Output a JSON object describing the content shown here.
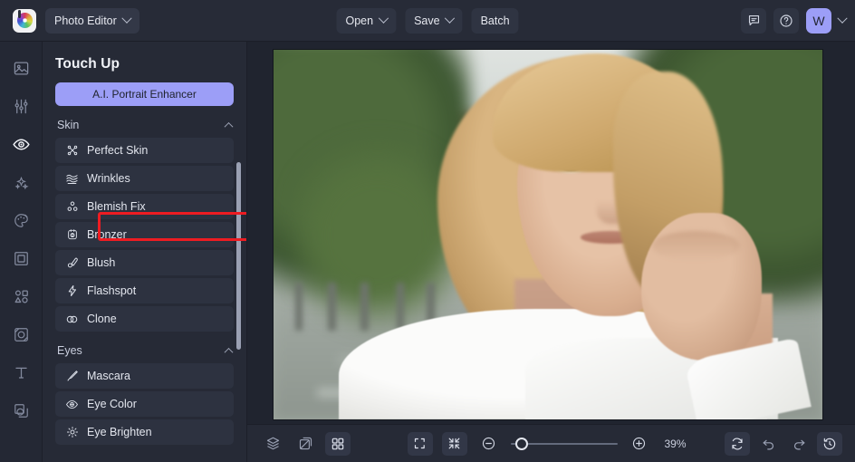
{
  "app": {
    "logo_icon": "color-wheel-logo",
    "mode_label": "Photo Editor"
  },
  "topbar": {
    "open_label": "Open",
    "save_label": "Save",
    "batch_label": "Batch",
    "feedback_icon": "chat-bubble-icon",
    "help_icon": "question-mark-circle-icon",
    "avatar_initial": "W",
    "avatar_color": "#9c9ef7"
  },
  "rail": {
    "items": [
      {
        "name": "image",
        "icon": "image-icon",
        "active": false
      },
      {
        "name": "adjust",
        "icon": "sliders-icon",
        "active": false
      },
      {
        "name": "touchup",
        "icon": "eye-icon",
        "active": true
      },
      {
        "name": "effects",
        "icon": "sparkles-icon",
        "active": false
      },
      {
        "name": "color",
        "icon": "palette-icon",
        "active": false
      },
      {
        "name": "frame",
        "icon": "frame-icon",
        "active": false
      },
      {
        "name": "shapes",
        "icon": "shapes-icon",
        "active": false
      },
      {
        "name": "texture",
        "icon": "texture-icon",
        "active": false
      },
      {
        "name": "text",
        "icon": "text-t-icon",
        "active": false
      },
      {
        "name": "layers",
        "icon": "overlay-icon",
        "active": false
      }
    ]
  },
  "panel": {
    "title": "Touch Up",
    "ai_button_label": "A.I. Portrait Enhancer",
    "ai_button_color": "#9c9ef7",
    "highlight_color": "#ee1c22",
    "sections": [
      {
        "label": "Skin",
        "collapse_icon": "chevron-up-icon",
        "items": [
          {
            "label": "Perfect Skin",
            "icon": "perfect-skin-icon",
            "highlighted": false
          },
          {
            "label": "Wrinkles",
            "icon": "wrinkles-icon",
            "highlighted": true
          },
          {
            "label": "Blemish Fix",
            "icon": "blemish-fix-icon",
            "highlighted": false
          },
          {
            "label": "Bronzer",
            "icon": "bronzer-icon",
            "highlighted": false
          },
          {
            "label": "Blush",
            "icon": "blush-brush-icon",
            "highlighted": false
          },
          {
            "label": "Flashspot",
            "icon": "lightning-icon",
            "highlighted": false
          },
          {
            "label": "Clone",
            "icon": "clone-icon",
            "highlighted": false
          }
        ]
      },
      {
        "label": "Eyes",
        "collapse_icon": "chevron-up-icon",
        "items": [
          {
            "label": "Mascara",
            "icon": "mascara-wand-icon",
            "highlighted": false
          },
          {
            "label": "Eye Color",
            "icon": "eye-color-icon",
            "highlighted": false
          },
          {
            "label": "Eye Brighten",
            "icon": "eye-brighten-icon",
            "highlighted": false
          }
        ]
      }
    ]
  },
  "canvas": {
    "image_description": "Portrait photo of an older blonde woman in a white blouse resting her cheek on her hand, blurred tree-lined street in the background"
  },
  "bottombar": {
    "left_tools": [
      {
        "name": "layers",
        "icon": "layers-stack-icon",
        "active": false
      },
      {
        "name": "compare",
        "icon": "compare-split-icon",
        "active": false
      },
      {
        "name": "grid",
        "icon": "grid-four-icon",
        "active": true
      }
    ],
    "view_tools": [
      {
        "name": "fullscreen",
        "icon": "expand-brackets-icon",
        "active": true
      },
      {
        "name": "fit-screen",
        "icon": "collapse-arrows-icon",
        "active": true
      }
    ],
    "zoom_out_icon": "minus-circle-icon",
    "zoom_in_icon": "plus-circle-icon",
    "zoom_level": "39%",
    "zoom_slider_position_pct": 12,
    "right_tools": [
      {
        "name": "reset",
        "icon": "refresh-icon",
        "active": true
      },
      {
        "name": "undo",
        "icon": "undo-arrow-icon",
        "active": false
      },
      {
        "name": "redo",
        "icon": "redo-arrow-icon",
        "active": false
      },
      {
        "name": "history",
        "icon": "clock-history-icon",
        "active": true
      }
    ]
  }
}
